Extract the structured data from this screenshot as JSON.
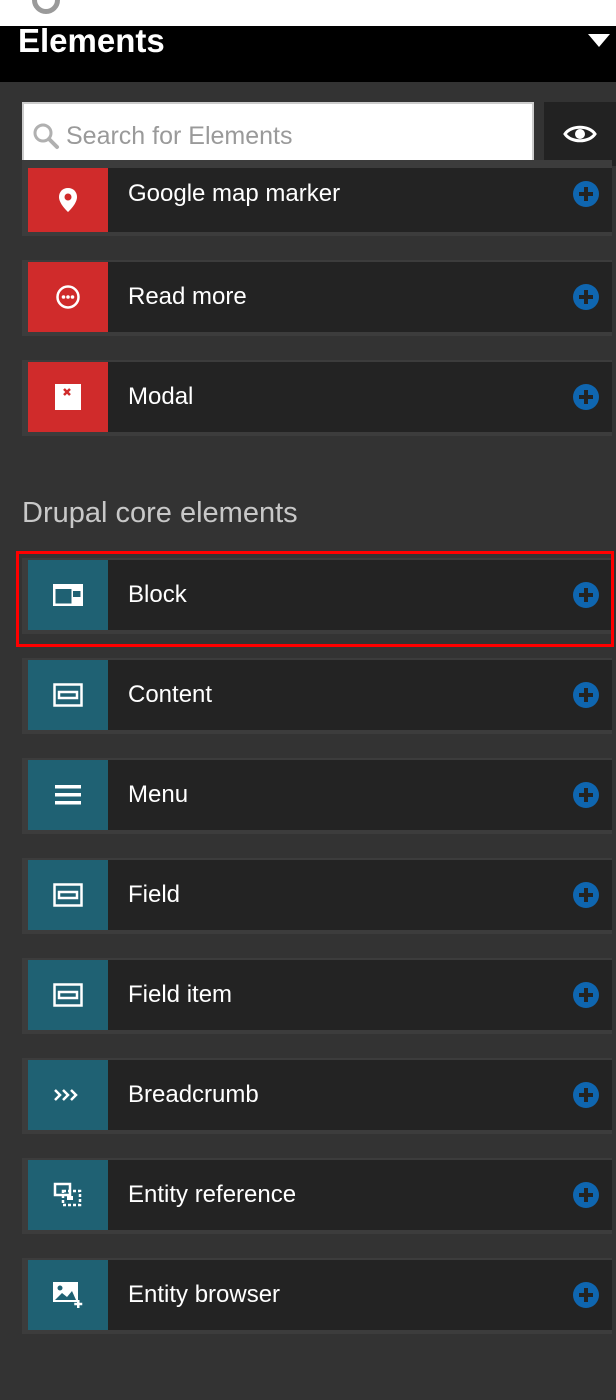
{
  "header": {
    "title": "Elements"
  },
  "search": {
    "placeholder": "Search for Elements"
  },
  "colors": {
    "custom_icon_bg": "#d02b2b",
    "core_icon_bg": "#1f6173",
    "add_button": "#0f66b0",
    "highlight": "#ff0000"
  },
  "custom_elements": [
    {
      "label": "Google map marker",
      "icon": "map-marker-icon"
    },
    {
      "label": "Read more",
      "icon": "ellipsis-circle-icon"
    },
    {
      "label": "Modal",
      "icon": "modal-close-icon"
    }
  ],
  "core_section": {
    "title": "Drupal core elements"
  },
  "core_elements": [
    {
      "label": "Block",
      "icon": "block-icon",
      "highlighted": true
    },
    {
      "label": "Content",
      "icon": "content-icon"
    },
    {
      "label": "Menu",
      "icon": "menu-icon"
    },
    {
      "label": "Field",
      "icon": "field-icon"
    },
    {
      "label": "Field item",
      "icon": "field-item-icon"
    },
    {
      "label": "Breadcrumb",
      "icon": "breadcrumb-icon"
    },
    {
      "label": "Entity reference",
      "icon": "entity-reference-icon"
    },
    {
      "label": "Entity browser",
      "icon": "entity-browser-icon"
    }
  ]
}
